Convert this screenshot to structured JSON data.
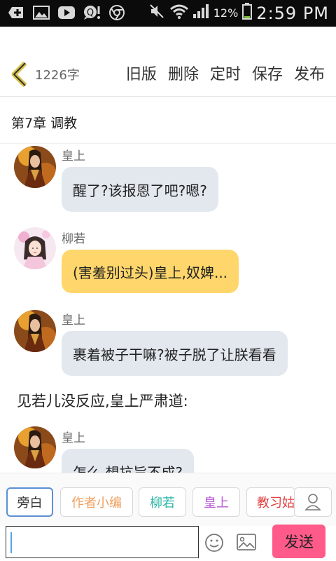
{
  "status_bar": {
    "battery_pct": "12%",
    "time": "2:59 PM",
    "icons": [
      "plus-box-icon",
      "image-icon",
      "play-icon",
      "chat-alert-icon",
      "chrome-icon",
      "mute-icon",
      "wifi-icon",
      "signal-icon",
      "battery-icon"
    ]
  },
  "toolbar": {
    "word_count": "1226字",
    "old_version": "旧版",
    "delete": "删除",
    "schedule": "定时",
    "save": "保存",
    "publish": "发布"
  },
  "chapter": {
    "title": "第7章 调教"
  },
  "messages": [
    {
      "type": "bubble",
      "speaker": "皇上",
      "text": "醒了?该报恩了吧?嗯?",
      "bubble_color": "#e3e8ef",
      "avatar": "emperor"
    },
    {
      "type": "bubble",
      "speaker": "柳若",
      "text": "(害羞别过头)皇上,奴婢...",
      "bubble_color": "#ffd66b",
      "avatar": "liuruo"
    },
    {
      "type": "bubble",
      "speaker": "皇上",
      "text": "裹着被子干嘛?被子脱了让朕看看",
      "bubble_color": "#e3e8ef",
      "avatar": "emperor"
    },
    {
      "type": "narration",
      "text": "见若儿没反应,皇上严肃道:"
    },
    {
      "type": "bubble",
      "speaker": "皇上",
      "text": "怎么,想抗旨不成?",
      "bubble_color": "#e3e8ef",
      "avatar": "emperor"
    }
  ],
  "roles": [
    {
      "label": "旁白",
      "color": "#333333"
    },
    {
      "label": "作者小编",
      "color": "#f0a060"
    },
    {
      "label": "柳若",
      "color": "#2ab5a5"
    },
    {
      "label": "皇上",
      "color": "#b95bd6"
    },
    {
      "label": "教习姑",
      "color": "#e04040"
    }
  ],
  "input": {
    "value": "",
    "placeholder": ""
  },
  "send_label": "发送"
}
